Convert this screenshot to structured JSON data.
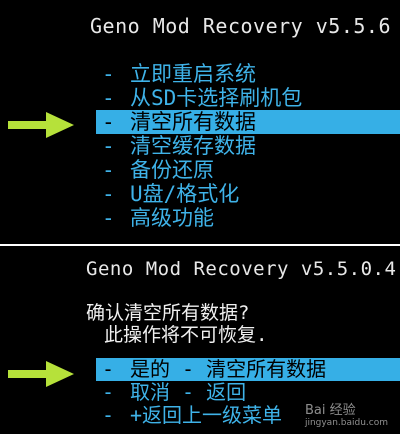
{
  "top_screen": {
    "title": "Geno Mod Recovery v5.5.6",
    "menu": [
      {
        "dash": "-",
        "label": "立即重启系统"
      },
      {
        "dash": "-",
        "label": "从SD卡选择刷机包"
      },
      {
        "dash": "-",
        "label": "清空所有数据",
        "selected": true
      },
      {
        "dash": "-",
        "label": "清空缓存数据"
      },
      {
        "dash": "-",
        "label": "备份还原"
      },
      {
        "dash": "-",
        "label": "U盘/格式化"
      },
      {
        "dash": "-",
        "label": "高级功能"
      }
    ]
  },
  "bottom_screen": {
    "title": "Geno Mod Recovery v5.5.0.4",
    "confirm_line1": "确认清空所有数据?",
    "confirm_line2": "此操作将不可恢复.",
    "menu": [
      {
        "dash": "-",
        "label": "是的 - 清空所有数据",
        "selected": true
      },
      {
        "dash": "-",
        "label": "取消 - 返回"
      },
      {
        "dash": "-",
        "label": "+返回上一级菜单"
      }
    ]
  },
  "watermark": {
    "text": "Bai 经验",
    "sub": "jingyan.baidu.com"
  },
  "colors": {
    "background": "#000000",
    "menu_text": "#3fb3e9",
    "highlight": "#36afe6",
    "arrow": "#b6e13a"
  }
}
